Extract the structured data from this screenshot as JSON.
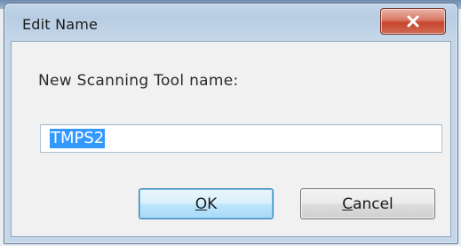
{
  "window": {
    "title": "Edit Name",
    "close_icon": "close-icon"
  },
  "dialog": {
    "prompt": "New Scanning Tool name:",
    "name_value": "TMPS2",
    "name_selected": true
  },
  "buttons": {
    "ok": {
      "accel": "O",
      "rest": "K"
    },
    "cancel": {
      "accel": "C",
      "rest": "ancel"
    }
  },
  "colors": {
    "selection": "#3399ff",
    "close_button": "#c7452e",
    "default_button": "#bee6fd"
  }
}
